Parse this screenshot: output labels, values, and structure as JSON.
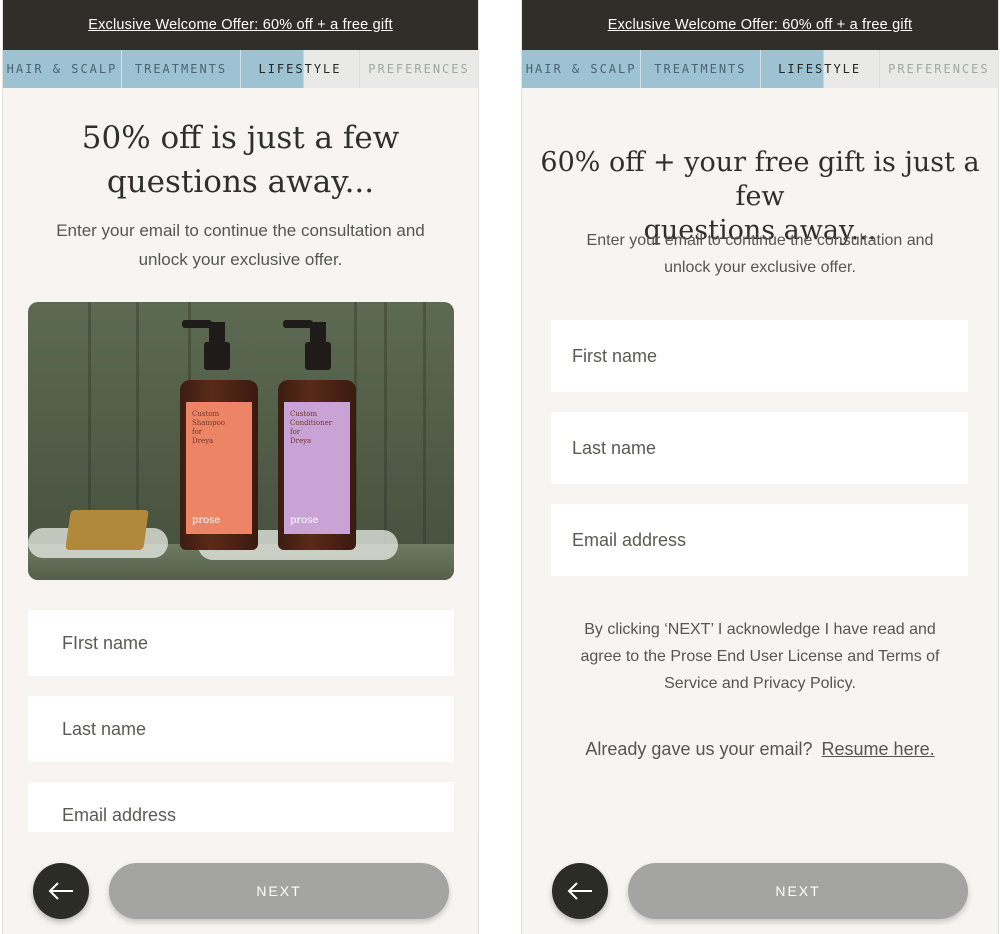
{
  "screen_a": {
    "banner": "Exclusive Welcome Offer: 60% off + a free gift",
    "steps": [
      "HAIR & SCALP",
      "TREATMENTS",
      "LIFESTYLE",
      "PREFERENCES"
    ],
    "title_line1": "50% off is just a few",
    "title_line2": "questions away...",
    "subtitle_line1": "Enter your email to continue the consultation and",
    "subtitle_line2": "unlock your exclusive offer.",
    "product_image": {
      "shampoo_label": [
        "Custom",
        "Shampoo",
        "for",
        "Dreya"
      ],
      "conditioner_label": [
        "Custom",
        "Conditioner",
        "for",
        "Dreya"
      ],
      "brand": "prose",
      "shampoo_color": "#ee8466",
      "conditioner_color": "#c9a3d6"
    },
    "fields": {
      "first_name": "FIrst name",
      "last_name": "Last name",
      "email": "Email address"
    },
    "next_label": "NEXT",
    "back_icon": "arrow-left-icon"
  },
  "screen_b": {
    "banner": "Exclusive Welcome Offer: 60% off + a free gift",
    "steps": [
      "HAIR & SCALP",
      "TREATMENTS",
      "LIFESTYLE",
      "PREFERENCES"
    ],
    "title_line1": "60% off + your free gift is just a few",
    "title_line2": "questions away...",
    "subtitle_line1": "Enter your email to continue the consultation and",
    "subtitle_line2": "unlock your exclusive offer.",
    "fields": {
      "first_name": "First name",
      "last_name": "Last name",
      "email": "Email address"
    },
    "legal_line1": "By clicking ‘NEXT’ I acknowledge I have read and",
    "legal_line2": "agree to the Prose End User License and Terms of",
    "legal_line3": "Service and Privacy Policy.",
    "resume_prompt": "Already gave us your email?",
    "resume_link": "Resume here.",
    "next_label": "NEXT",
    "back_icon": "arrow-left-icon"
  },
  "colors": {
    "banner_bg": "#2f2e28",
    "step_done": "#9dc2d1",
    "step_todo": "#e9eae8",
    "next_button": "#a4a4a2",
    "back_button": "#2c2c26"
  }
}
